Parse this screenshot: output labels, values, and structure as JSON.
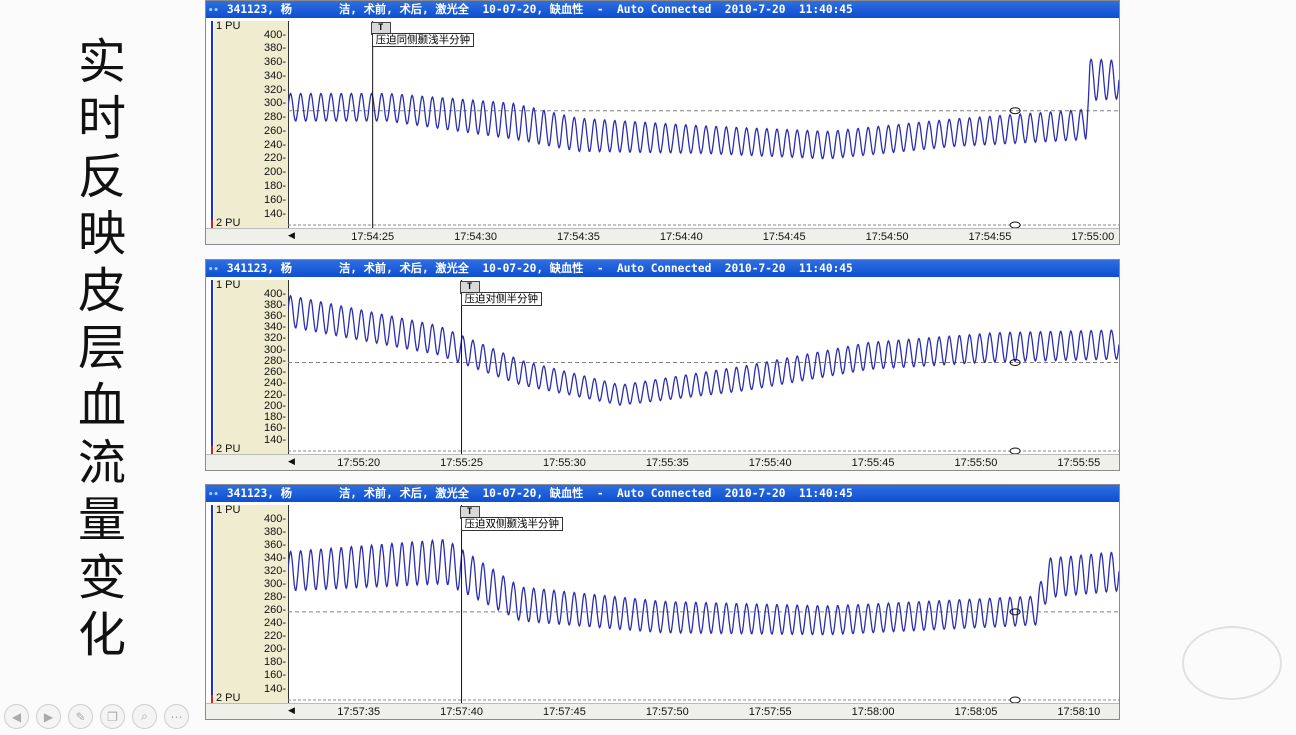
{
  "slide_title_chars": [
    "实",
    "时",
    "反",
    "映",
    "皮",
    "层",
    "血",
    "流",
    "量",
    "变",
    "化"
  ],
  "panels": [
    {
      "title": "341123, 杨       洁, 术前, 术后, 激光全  10-07-20, 缺血性  -  Auto Connected  2010-7-20  11:40:45",
      "top_label": "1 PU",
      "bottom_label": "2 PU",
      "y_ticks": [
        "400",
        "380",
        "360",
        "340",
        "320",
        "300",
        "280",
        "260",
        "240",
        "220",
        "200",
        "180",
        "160",
        "140"
      ],
      "x_ticks": [
        "17:54:25",
        "17:54:30",
        "17:54:35",
        "17:54:40",
        "17:54:45",
        "17:54:50",
        "17:54:55",
        "17:55:00"
      ],
      "marker_letter": "T",
      "annotation": "压迫同侧颞浅半分钟",
      "baseline_value": 290,
      "marker_tick_index": 0,
      "trace": [
        {
          "t": 0.0,
          "c": 295,
          "a": 20
        },
        {
          "t": 0.12,
          "c": 295,
          "a": 20
        },
        {
          "t": 0.27,
          "c": 275,
          "a": 26
        },
        {
          "t": 0.35,
          "c": 255,
          "a": 24
        },
        {
          "t": 0.5,
          "c": 248,
          "a": 20
        },
        {
          "t": 0.65,
          "c": 240,
          "a": 20
        },
        {
          "t": 0.8,
          "c": 258,
          "a": 20
        },
        {
          "t": 0.96,
          "c": 270,
          "a": 22
        },
        {
          "t": 0.965,
          "c": 335,
          "a": 30
        },
        {
          "t": 1.0,
          "c": 335,
          "a": 28
        }
      ]
    },
    {
      "title": "341123, 杨       洁, 术前, 术后, 激光全  10-07-20, 缺血性  -  Auto Connected  2010-7-20  11:40:45",
      "top_label": "1 PU",
      "bottom_label": "2 PU",
      "y_ticks": [
        "400",
        "380",
        "360",
        "340",
        "320",
        "300",
        "280",
        "260",
        "240",
        "220",
        "200",
        "180",
        "160",
        "140"
      ],
      "x_ticks": [
        "17:55:20",
        "17:55:25",
        "17:55:30",
        "17:55:35",
        "17:55:40",
        "17:55:45",
        "17:55:50",
        "17:55:55"
      ],
      "marker_letter": "T",
      "annotation": "压迫对侧半分钟",
      "baseline_value": 278,
      "marker_tick_index": 1,
      "trace": [
        {
          "t": 0.0,
          "c": 370,
          "a": 28
        },
        {
          "t": 0.18,
          "c": 318,
          "a": 26
        },
        {
          "t": 0.28,
          "c": 260,
          "a": 22
        },
        {
          "t": 0.4,
          "c": 220,
          "a": 18
        },
        {
          "t": 0.55,
          "c": 250,
          "a": 22
        },
        {
          "t": 0.7,
          "c": 290,
          "a": 24
        },
        {
          "t": 0.85,
          "c": 305,
          "a": 26
        },
        {
          "t": 1.0,
          "c": 310,
          "a": 26
        }
      ]
    },
    {
      "title": "341123, 杨       洁, 术前, 术后, 激光全  10-07-20, 缺血性  -  Auto Connected  2010-7-20  11:40:45",
      "top_label": "1 PU",
      "bottom_label": "2 PU",
      "y_ticks": [
        "400",
        "380",
        "360",
        "340",
        "320",
        "300",
        "280",
        "260",
        "240",
        "220",
        "200",
        "180",
        "160",
        "140"
      ],
      "x_ticks": [
        "17:57:35",
        "17:57:40",
        "17:57:45",
        "17:57:50",
        "17:57:55",
        "17:58:00",
        "17:58:05",
        "17:58:10"
      ],
      "marker_letter": "T",
      "annotation": "压迫双侧颞浅半分钟",
      "baseline_value": 258,
      "marker_tick_index": 1,
      "trace": [
        {
          "t": 0.0,
          "c": 320,
          "a": 30
        },
        {
          "t": 0.19,
          "c": 335,
          "a": 34
        },
        {
          "t": 0.28,
          "c": 270,
          "a": 26
        },
        {
          "t": 0.45,
          "c": 250,
          "a": 24
        },
        {
          "t": 0.65,
          "c": 245,
          "a": 22
        },
        {
          "t": 0.9,
          "c": 260,
          "a": 22
        },
        {
          "t": 0.915,
          "c": 310,
          "a": 30
        },
        {
          "t": 1.0,
          "c": 320,
          "a": 30
        }
      ]
    }
  ],
  "colors": {
    "trace": "#2a2fb0",
    "baseline": "#808080",
    "titlebar": "#0d4fd1"
  },
  "icons": [
    "prev-icon",
    "next-icon",
    "pen-icon",
    "copy-icon",
    "zoom-icon",
    "more-icon"
  ]
}
